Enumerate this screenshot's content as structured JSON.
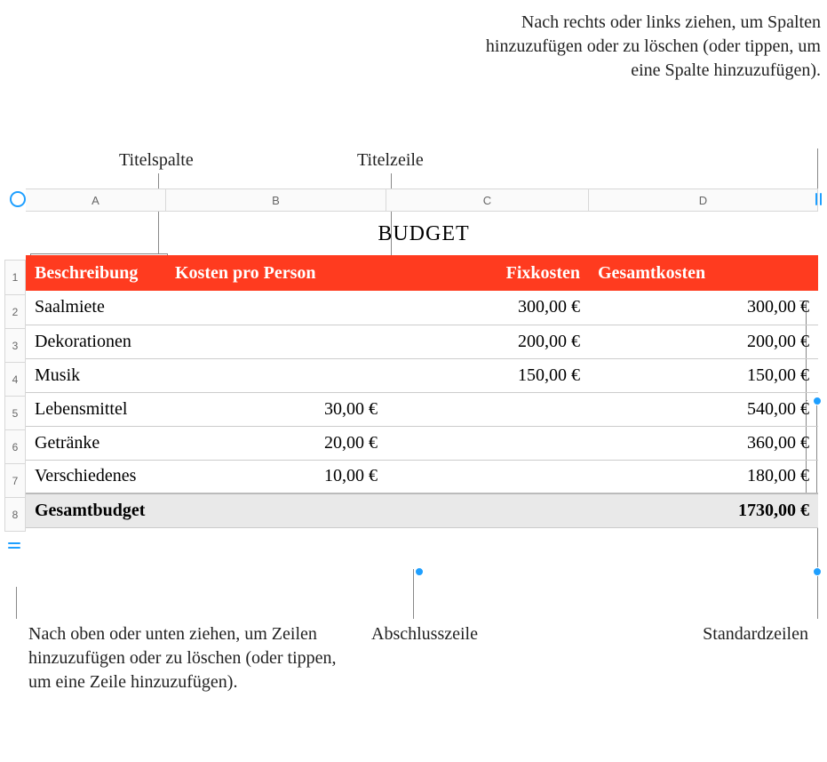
{
  "callouts": {
    "title_column": "Titelspalte",
    "title_row": "Titelzeile",
    "columns_hint": "Nach rechts oder links ziehen, um Spalten hinzuzufügen oder zu löschen (oder tippen, um eine Spalte hinzuzufügen).",
    "rows_hint": "Nach oben oder unten ziehen, um Zeilen hinzuzufügen oder zu löschen (oder tippen, um eine Zeile hinzuzufügen).",
    "footer_row": "Abschlusszeile",
    "body_rows": "Standardzeilen"
  },
  "table": {
    "title": "BUDGET",
    "columns": [
      "A",
      "B",
      "C",
      "D"
    ],
    "row_numbers": [
      "1",
      "2",
      "3",
      "4",
      "5",
      "6",
      "7",
      "8"
    ],
    "headers": {
      "desc": "Beschreibung",
      "per_person": "Kosten pro Person",
      "fixed": "Fixkosten",
      "total": "Gesamtkosten"
    },
    "rows": [
      {
        "desc": "Saalmiete",
        "per_person": "",
        "fixed": "300,00 €",
        "total": "300,00 €"
      },
      {
        "desc": "Dekorationen",
        "per_person": "",
        "fixed": "200,00 €",
        "total": "200,00 €"
      },
      {
        "desc": "Musik",
        "per_person": "",
        "fixed": "150,00 €",
        "total": "150,00 €"
      },
      {
        "desc": "Lebensmittel",
        "per_person": "30,00 €",
        "fixed": "",
        "total": "540,00 €"
      },
      {
        "desc": "Getränke",
        "per_person": "20,00 €",
        "fixed": "",
        "total": "360,00 €"
      },
      {
        "desc": "Verschiedenes",
        "per_person": "10,00 €",
        "fixed": "",
        "total": "180,00 €"
      }
    ],
    "footer": {
      "label": "Gesamtbudget",
      "total": "1730,00 €"
    }
  }
}
